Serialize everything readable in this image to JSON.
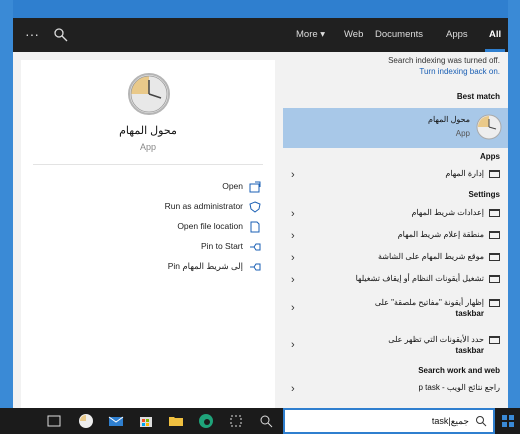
{
  "topbar": {
    "more_dots": "···",
    "tabs": [
      "All",
      "Apps",
      "Documents",
      "Web",
      "More ▾"
    ]
  },
  "left": {
    "app_name": "محول المهام",
    "app_type": "App",
    "actions": [
      "Open",
      "Run as administrator",
      "Open file location",
      "Pin to Start",
      "Pin إلى شريط المهام"
    ]
  },
  "right": {
    "notice_line1": "Search indexing was turned off.",
    "notice_line2": "Turn indexing back on.",
    "best_match_heading": "Best match",
    "best_match": {
      "name": "محول المهام",
      "type": "App"
    },
    "apps_heading": "Apps",
    "apps": [
      "إدارة المهام"
    ],
    "settings_heading": "Settings",
    "settings": [
      "إعدادات شريط المهام",
      "منطقة إعلام شريط المهام",
      "موقع شريط المهام على الشاشة",
      "تشغيل أيقونات النظام أو إيقاف تشغيلها",
      "إظهار أيقونة \"مفاتيح ملصقة\" على",
      "حدد الأيقونات التي تظهر على"
    ],
    "settings_line2": "taskbar",
    "web_heading": "Search work and web",
    "web_result": "p task - راجع نتائج الويب"
  },
  "taskbar": {
    "search_text": "task|جميع"
  }
}
